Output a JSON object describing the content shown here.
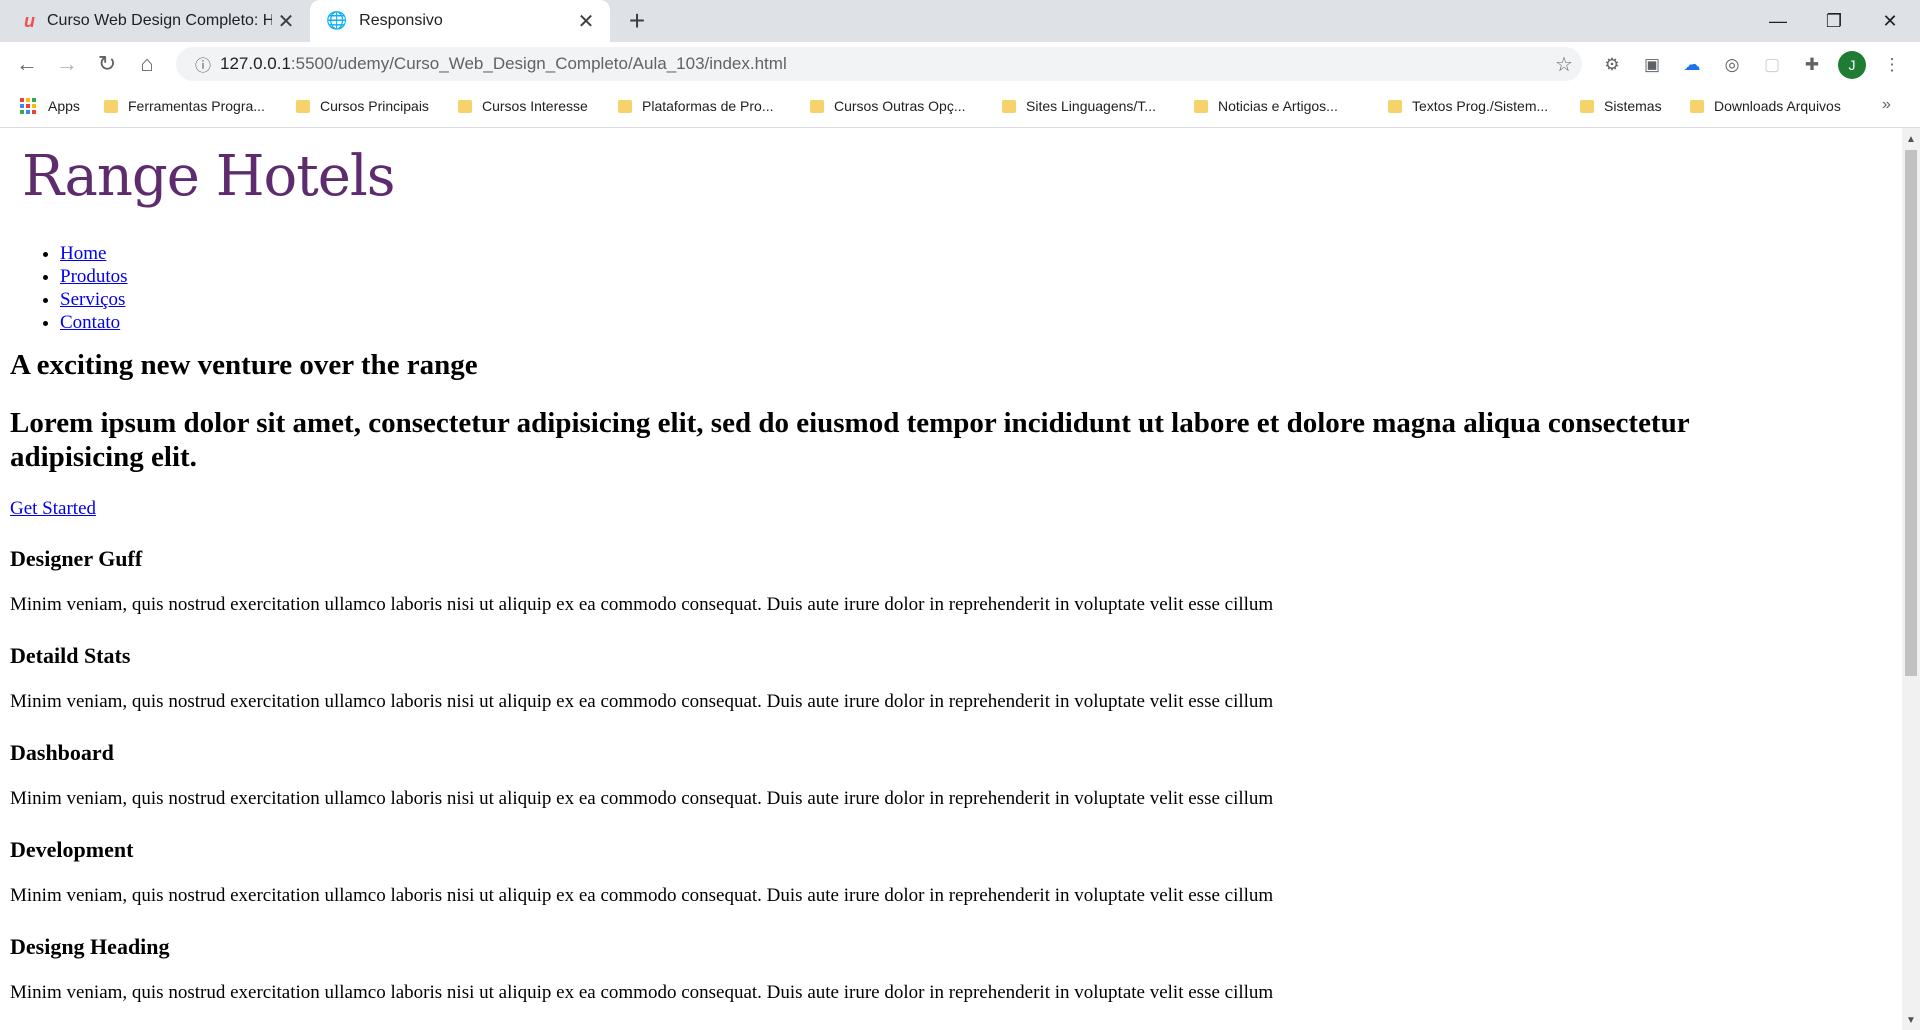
{
  "browser": {
    "tabs": [
      {
        "title": "Curso Web Design Completo: HT",
        "icon": "udemy-logo-icon"
      },
      {
        "title": "Responsivo",
        "icon": "globe-icon"
      }
    ],
    "url": {
      "host": "127.0.0.1",
      "rest": ":5500/udemy/Curso_Web_Design_Completo/Aula_103/index.html"
    },
    "profile_initial": "J",
    "bookmarks": [
      "Apps",
      "Ferramentas Progra...",
      "Cursos Principais",
      "Cursos Interesse",
      "Plataformas de Pro...",
      "Cursos Outras Opç...",
      "Sites Linguagens/T...",
      "Noticias e Artigos...",
      "Textos Prog./Sistem...",
      "Sistemas",
      "Downloads Arquivos"
    ],
    "bookmarks_more": "»"
  },
  "page": {
    "logo": "Range Hotels",
    "nav": [
      "Home",
      "Produtos",
      "Serviços",
      "Contato"
    ],
    "headline": "A exciting new venture over the range",
    "subheadline": "Lorem ipsum dolor sit amet, consectetur adipisicing elit, sed do eiusmod tempor incididunt ut labore et dolore magna aliqua consectetur adipisicing elit.",
    "cta": "Get Started",
    "features": [
      {
        "title": "Designer Guff",
        "text": "Minim veniam, quis nostrud exercitation ullamco laboris nisi ut aliquip ex ea commodo consequat. Duis aute irure dolor in reprehenderit in voluptate velit esse cillum"
      },
      {
        "title": "Detaild Stats",
        "text": "Minim veniam, quis nostrud exercitation ullamco laboris nisi ut aliquip ex ea commodo consequat. Duis aute irure dolor in reprehenderit in voluptate velit esse cillum"
      },
      {
        "title": "Dashboard",
        "text": "Minim veniam, quis nostrud exercitation ullamco laboris nisi ut aliquip ex ea commodo consequat. Duis aute irure dolor in reprehenderit in voluptate velit esse cillum"
      },
      {
        "title": "Development",
        "text": "Minim veniam, quis nostrud exercitation ullamco laboris nisi ut aliquip ex ea commodo consequat. Duis aute irure dolor in reprehenderit in voluptate velit esse cillum"
      },
      {
        "title": "Designg Heading",
        "text": "Minim veniam, quis nostrud exercitation ullamco laboris nisi ut aliquip ex ea commodo consequat. Duis aute irure dolor in reprehenderit in voluptate velit esse cillum"
      }
    ]
  },
  "colors": {
    "logo": "#5e2c6e",
    "link": "#0000ee",
    "tabbar": "#dee1e6"
  }
}
